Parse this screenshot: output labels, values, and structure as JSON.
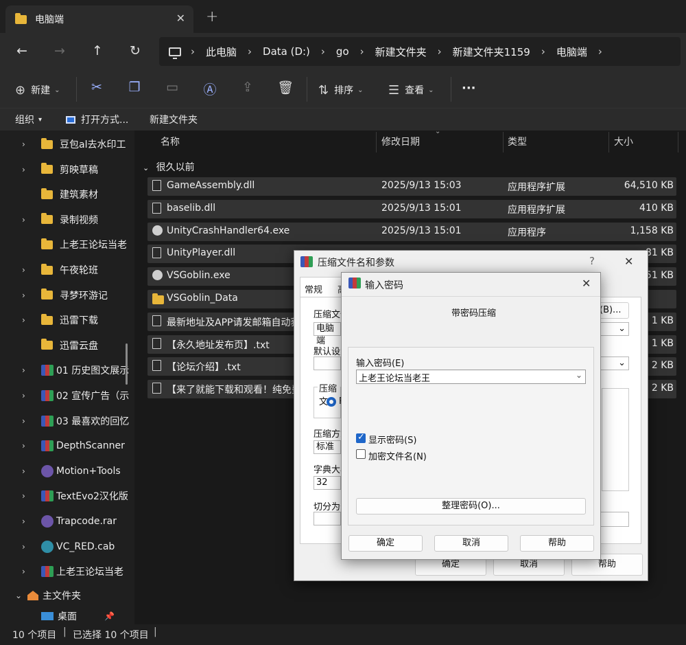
{
  "tab": {
    "title": "电脑端",
    "close": "✕",
    "new": "+"
  },
  "nav": {
    "back": "←",
    "forward": "→",
    "up": "↑",
    "refresh": "↻"
  },
  "breadcrumb": [
    "此电脑",
    "Data (D:)",
    "go",
    "新建文件夹",
    "新建文件夹1159",
    "电脑端"
  ],
  "breadcrumb_sep": "›",
  "toolbar": {
    "new_label": "新建",
    "sort_label": "排序",
    "view_label": "查看",
    "more": "···"
  },
  "subbar": {
    "organize": "组织",
    "open_with": "打开方式...",
    "new_folder": "新建文件夹"
  },
  "sidebar": {
    "items": [
      {
        "label": "豆包al去水印工",
        "type": "folder",
        "chev": true
      },
      {
        "label": "剪映草稿",
        "type": "folder",
        "chev": true
      },
      {
        "label": "建筑素材",
        "type": "folder",
        "chev": false
      },
      {
        "label": "录制视频",
        "type": "folder",
        "chev": true
      },
      {
        "label": "上老王论坛当老",
        "type": "folder",
        "chev": false
      },
      {
        "label": "午夜轮班",
        "type": "folder",
        "chev": true
      },
      {
        "label": "寻梦环游记",
        "type": "folder",
        "chev": true
      },
      {
        "label": "迅雷下载",
        "type": "folder",
        "chev": true
      },
      {
        "label": "迅雷云盘",
        "type": "folder",
        "chev": false
      },
      {
        "label": "01 历史图文展示",
        "type": "rar",
        "chev": true
      },
      {
        "label": "02 宣传广告（示",
        "type": "rar",
        "chev": true
      },
      {
        "label": "03 最喜欢的回忆",
        "type": "rar",
        "chev": true
      },
      {
        "label": "DepthScanner",
        "type": "rar",
        "chev": true
      },
      {
        "label": "Motion+Tools",
        "type": "circle",
        "chev": true
      },
      {
        "label": "TextEvo2汉化版",
        "type": "rar",
        "chev": true
      },
      {
        "label": "Trapcode.rar",
        "type": "circle",
        "chev": true
      },
      {
        "label": "VC_RED.cab",
        "type": "cab",
        "chev": true
      },
      {
        "label": "上老王论坛当老",
        "type": "rar",
        "chev": true
      }
    ],
    "home": "主文件夹",
    "desktop": "桌面"
  },
  "columns": {
    "name": "名称",
    "date": "修改日期",
    "type": "类型",
    "size": "大小"
  },
  "group_label": "很久以前",
  "files": [
    {
      "name": "GameAssembly.dll",
      "date": "2025/9/13 15:03",
      "type": "应用程序扩展",
      "size": "64,510 KB",
      "icon": "doc"
    },
    {
      "name": "baselib.dll",
      "date": "2025/9/13 15:01",
      "type": "应用程序扩展",
      "size": "410 KB",
      "icon": "doc"
    },
    {
      "name": "UnityCrashHandler64.exe",
      "date": "2025/9/13 15:01",
      "type": "应用程序",
      "size": "1,158 KB",
      "icon": "goblin"
    },
    {
      "name": "UnityPlayer.dll",
      "date": "",
      "type": "",
      "size": "81 KB",
      "icon": "doc"
    },
    {
      "name": "VSGoblin.exe",
      "date": "",
      "type": "",
      "size": "51 KB",
      "icon": "goblin"
    },
    {
      "name": "VSGoblin_Data",
      "date": "",
      "type": "",
      "size": "",
      "icon": "folder"
    },
    {
      "name": "最新地址及APP请发邮箱自动获",
      "date": "",
      "type": "",
      "size": "1 KB",
      "icon": "doc"
    },
    {
      "name": "【永久地址发布页】.txt",
      "date": "",
      "type": "",
      "size": "1 KB",
      "icon": "doc"
    },
    {
      "name": "【论坛介绍】.txt",
      "date": "",
      "type": "",
      "size": "2 KB",
      "icon": "doc"
    },
    {
      "name": "【来了就能下载和观看！纯免费",
      "date": "",
      "type": "",
      "size": "2 KB",
      "icon": "doc"
    }
  ],
  "status": {
    "count": "10 个项目",
    "selected": "已选择 10 个项目"
  },
  "archive_dialog": {
    "title": "压缩文件名和参数",
    "help": "?",
    "close": "✕",
    "tab_general": "常规",
    "tab_advanced": "高",
    "archive_name_label": "压缩文件",
    "archive_name_value": "电脑端",
    "browse": "(B)...",
    "default_profile_label": "默认设置",
    "format_label": "压缩文",
    "format_option": "R",
    "method_label": "压缩方式",
    "method_value": "标准",
    "dict_label": "字典大小",
    "dict_value": "32",
    "split_label": "切分为分",
    "ok": "确定",
    "cancel": "取消",
    "help_btn": "帮助"
  },
  "password_dialog": {
    "title": "输入密码",
    "close": "✕",
    "heading": "带密码压缩",
    "password_label": "输入密码(E)",
    "password_value": "上老王论坛当老王",
    "show_password": "显示密码(S)",
    "show_password_checked": true,
    "encrypt_names": "加密文件名(N)",
    "encrypt_names_checked": false,
    "organize": "整理密码(O)...",
    "ok": "确定",
    "cancel": "取消",
    "help": "帮助"
  }
}
